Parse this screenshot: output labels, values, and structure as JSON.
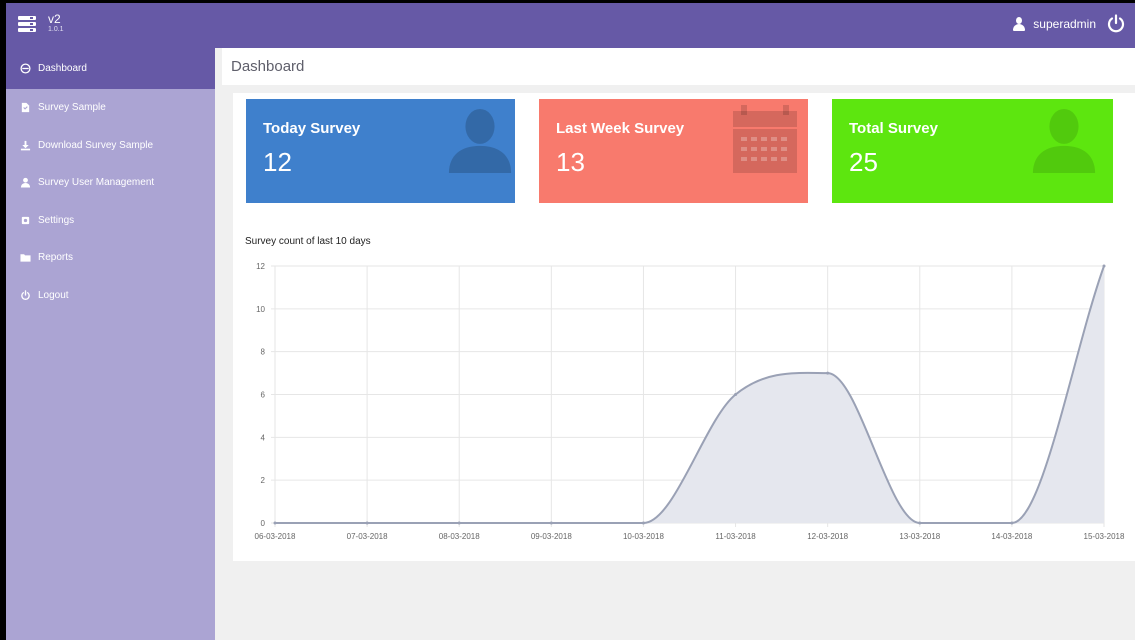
{
  "topbar": {
    "app_name": "v2",
    "version": "1.0.1",
    "username": "superadmin"
  },
  "sidebar": {
    "items": [
      {
        "label": "Dashboard",
        "icon": "dashboard-icon",
        "active": true
      },
      {
        "label": "Survey Sample",
        "icon": "file-icon"
      },
      {
        "label": "Download Survey Sample",
        "icon": "download-icon"
      },
      {
        "label": "Survey User Management",
        "icon": "user-icon"
      },
      {
        "label": "Settings",
        "icon": "gear-icon"
      },
      {
        "label": "Reports",
        "icon": "folder-icon"
      },
      {
        "label": "Logout",
        "icon": "power-icon"
      }
    ]
  },
  "page": {
    "title": "Dashboard"
  },
  "cards": [
    {
      "title": "Today Survey",
      "value": "12",
      "color": "#3f80cc",
      "icon": "user-silhouette-icon"
    },
    {
      "title": "Last Week Survey",
      "value": "13",
      "color": "#f87a6d",
      "icon": "calendar-icon"
    },
    {
      "title": "Total Survey",
      "value": "25",
      "color": "#5de60f",
      "icon": "user-silhouette-icon"
    }
  ],
  "chart_data": {
    "type": "area",
    "title": "Survey count of last 10 days",
    "categories": [
      "06-03-2018",
      "07-03-2018",
      "08-03-2018",
      "09-03-2018",
      "10-03-2018",
      "11-03-2018",
      "12-03-2018",
      "13-03-2018",
      "14-03-2018",
      "15-03-2018"
    ],
    "values": [
      0,
      0,
      0,
      0,
      0,
      6,
      7,
      0,
      0,
      12
    ],
    "ylim": [
      0,
      12
    ],
    "yticks": [
      0,
      2,
      4,
      6,
      8,
      10,
      12
    ],
    "grid": true,
    "line_color": "#9aa1b5",
    "fill_color": "#e5e7ee"
  }
}
